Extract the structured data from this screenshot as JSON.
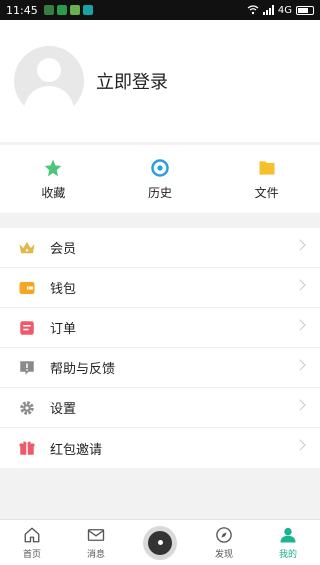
{
  "status": {
    "time": "11:45",
    "network": "4G"
  },
  "profile": {
    "login_label": "立即登录"
  },
  "quick": [
    {
      "label": "收藏",
      "icon": "star-icon"
    },
    {
      "label": "历史",
      "icon": "eye-icon"
    },
    {
      "label": "文件",
      "icon": "folder-icon"
    }
  ],
  "menu": [
    {
      "label": "会员",
      "icon": "crown-icon"
    },
    {
      "label": "钱包",
      "icon": "wallet-icon"
    },
    {
      "label": "订单",
      "icon": "order-icon"
    },
    {
      "label": "帮助与反馈",
      "icon": "help-icon"
    },
    {
      "label": "设置",
      "icon": "gear-icon"
    },
    {
      "label": "红包邀请",
      "icon": "gift-icon"
    }
  ],
  "tabs": [
    {
      "label": "首页",
      "icon": "home-icon"
    },
    {
      "label": "消息",
      "icon": "mail-icon"
    },
    {
      "label": "",
      "icon": "record-icon"
    },
    {
      "label": "发现",
      "icon": "compass-icon"
    },
    {
      "label": "我的",
      "icon": "person-icon"
    }
  ],
  "colors": {
    "accent": "#1ab394",
    "star": "#4cc67a",
    "eye": "#2aa0e0",
    "folder": "#f5c02c",
    "crown": "#e0b94a",
    "wallet": "#f5a623",
    "order": "#ef5a6b",
    "help": "#8a8a8a",
    "gift": "#ef5a6b"
  }
}
